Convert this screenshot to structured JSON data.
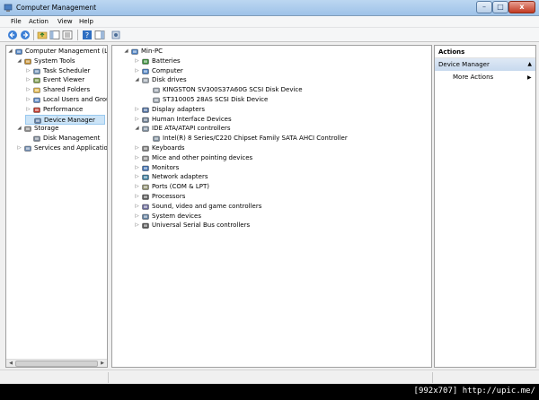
{
  "window": {
    "title": "Computer Management",
    "controls": {
      "minimize": "–",
      "maximize": "□",
      "close": "x"
    }
  },
  "menu": [
    "File",
    "Action",
    "View",
    "Help"
  ],
  "toolbar": [
    "back-arrow-icon",
    "forward-arrow-icon",
    "up-folder-icon",
    "show-hide-tree-icon",
    "help-icon",
    "action-pane-icon",
    "properties-icon"
  ],
  "left_tree": [
    {
      "label": "Computer Management (Local",
      "level": 0,
      "arrow": "◢",
      "icon": "computer-management-icon"
    },
    {
      "label": "System Tools",
      "level": 1,
      "arrow": "◢",
      "icon": "system-tools-icon"
    },
    {
      "label": "Task Scheduler",
      "level": 2,
      "arrow": "▷",
      "icon": "task-scheduler-icon"
    },
    {
      "label": "Event Viewer",
      "level": 2,
      "arrow": "▷",
      "icon": "event-viewer-icon"
    },
    {
      "label": "Shared Folders",
      "level": 2,
      "arrow": "▷",
      "icon": "shared-folders-icon"
    },
    {
      "label": "Local Users and Groups",
      "level": 2,
      "arrow": "▷",
      "icon": "local-users-icon"
    },
    {
      "label": "Performance",
      "level": 2,
      "arrow": "▷",
      "icon": "performance-icon"
    },
    {
      "label": "Device Manager",
      "level": 2,
      "arrow": "",
      "icon": "device-manager-icon",
      "selected": true
    },
    {
      "label": "Storage",
      "level": 1,
      "arrow": "◢",
      "icon": "storage-icon"
    },
    {
      "label": "Disk Management",
      "level": 2,
      "arrow": "",
      "icon": "disk-management-icon"
    },
    {
      "label": "Services and Applications",
      "level": 1,
      "arrow": "▷",
      "icon": "services-applications-icon"
    }
  ],
  "device_tree": [
    {
      "label": "Min-PC",
      "level": 0,
      "arrow": "◢",
      "icon": "computer-icon"
    },
    {
      "label": "Batteries",
      "level": 1,
      "arrow": "▷",
      "icon": "battery-icon"
    },
    {
      "label": "Computer",
      "level": 1,
      "arrow": "▷",
      "icon": "computer-icon"
    },
    {
      "label": "Disk drives",
      "level": 1,
      "arrow": "◢",
      "icon": "disk-drive-icon"
    },
    {
      "label": "KINGSTON SV300S37A60G SCSI Disk Device",
      "level": 2,
      "arrow": "",
      "icon": "disk-drive-icon"
    },
    {
      "label": "ST310005 28AS SCSI Disk Device",
      "level": 2,
      "arrow": "",
      "icon": "disk-drive-icon"
    },
    {
      "label": "Display adapters",
      "level": 1,
      "arrow": "▷",
      "icon": "display-adapter-icon"
    },
    {
      "label": "Human Interface Devices",
      "level": 1,
      "arrow": "▷",
      "icon": "hid-icon"
    },
    {
      "label": "IDE ATA/ATAPI controllers",
      "level": 1,
      "arrow": "◢",
      "icon": "ide-controller-icon"
    },
    {
      "label": "Intel(R) 8 Series/C220 Chipset Family SATA AHCI Controller",
      "level": 2,
      "arrow": "",
      "icon": "ide-controller-icon"
    },
    {
      "label": "Keyboards",
      "level": 1,
      "arrow": "▷",
      "icon": "keyboard-icon"
    },
    {
      "label": "Mice and other pointing devices",
      "level": 1,
      "arrow": "▷",
      "icon": "mouse-icon"
    },
    {
      "label": "Monitors",
      "level": 1,
      "arrow": "▷",
      "icon": "monitor-icon"
    },
    {
      "label": "Network adapters",
      "level": 1,
      "arrow": "▷",
      "icon": "network-adapter-icon"
    },
    {
      "label": "Ports (COM & LPT)",
      "level": 1,
      "arrow": "▷",
      "icon": "port-icon"
    },
    {
      "label": "Processors",
      "level": 1,
      "arrow": "▷",
      "icon": "processor-icon"
    },
    {
      "label": "Sound, video and game controllers",
      "level": 1,
      "arrow": "▷",
      "icon": "sound-icon"
    },
    {
      "label": "System devices",
      "level": 1,
      "arrow": "▷",
      "icon": "system-device-icon"
    },
    {
      "label": "Universal Serial Bus controllers",
      "level": 1,
      "arrow": "▷",
      "icon": "usb-icon"
    }
  ],
  "actions": {
    "title": "Actions",
    "section": "Device Manager",
    "section_arrow": "▲",
    "more": "More Actions",
    "more_arrow": "▶"
  },
  "scrollbar": {
    "left": "◀",
    "right": "▶"
  },
  "watermark": "[992x707] http://upic.me/",
  "colors": {
    "selection": "#cce4f7",
    "titlebar": "#9ec2e8",
    "close": "#c23a22"
  }
}
